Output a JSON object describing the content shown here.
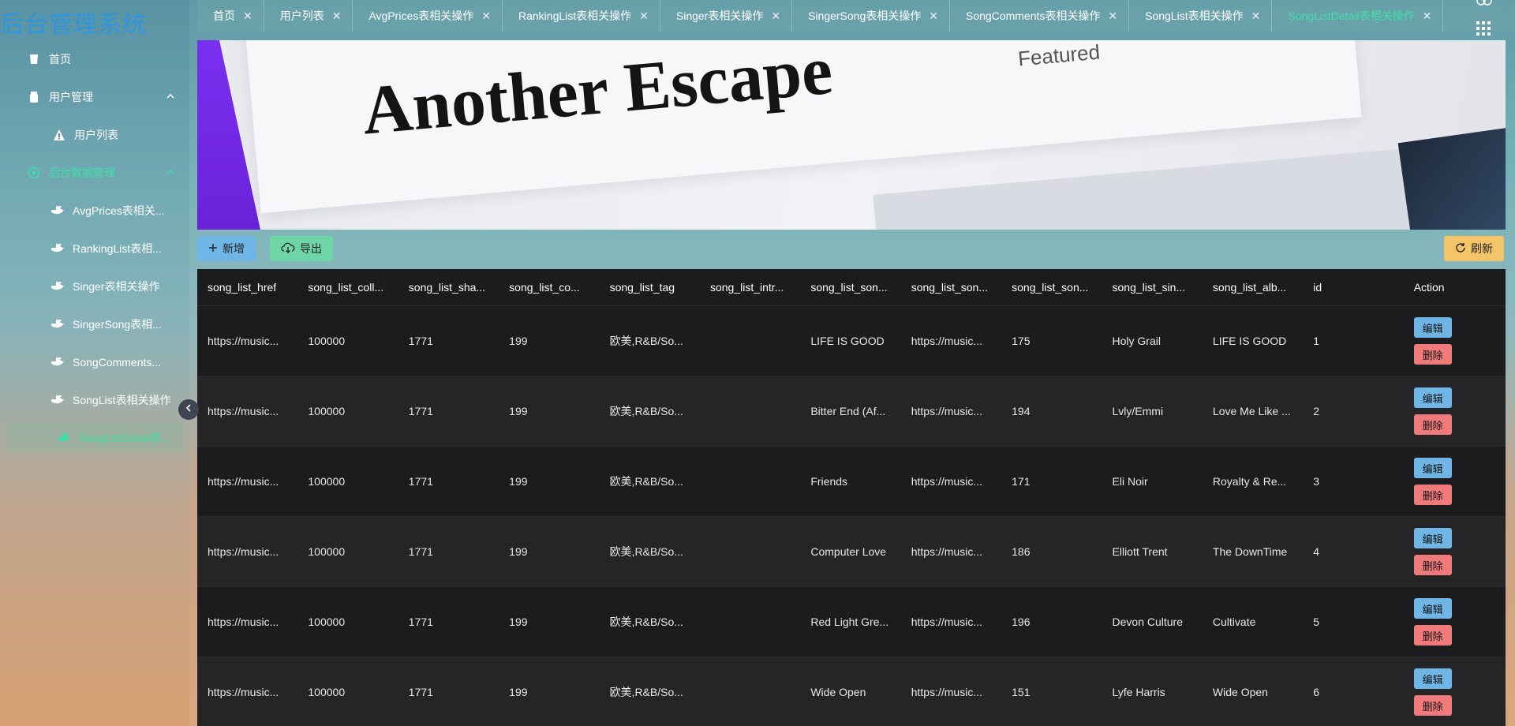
{
  "brand": "后台管理系统",
  "sidebar": {
    "items": [
      {
        "label": "首页",
        "icon": "cup-icon"
      },
      {
        "label": "用户管理",
        "icon": "bottle-icon",
        "expanded": true
      },
      {
        "label": "用户列表",
        "icon": "warning-icon"
      },
      {
        "label": "后台数据管理",
        "icon": "orbit-icon",
        "expanded": true
      },
      {
        "label": "AvgPrices表相关...",
        "icon": "whale-icon"
      },
      {
        "label": "RankingList表相...",
        "icon": "whale-icon"
      },
      {
        "label": "Singer表相关操作",
        "icon": "whale-icon"
      },
      {
        "label": "SingerSong表相...",
        "icon": "whale-icon"
      },
      {
        "label": "SongComments...",
        "icon": "whale-icon"
      },
      {
        "label": "SongList表相关操作",
        "icon": "whale-icon"
      },
      {
        "label": "SongListDetail表...",
        "icon": "whale-icon"
      }
    ]
  },
  "tabs": [
    {
      "label": "首页"
    },
    {
      "label": "用户列表"
    },
    {
      "label": "AvgPrices表相关操作"
    },
    {
      "label": "RankingList表相关操作"
    },
    {
      "label": "Singer表相关操作"
    },
    {
      "label": "SingerSong表相关操作"
    },
    {
      "label": "SongComments表相关操作"
    },
    {
      "label": "SongList表相关操作"
    },
    {
      "label": "SongListDetail表相关操作"
    }
  ],
  "banner": {
    "title": "Another Escape",
    "feature_text": "Featured",
    "slide_count": 4,
    "active_slide": 1
  },
  "toolbar": {
    "add_label": "新增",
    "export_label": "导出",
    "refresh_label": "刷新"
  },
  "table": {
    "columns": [
      "song_list_href",
      "song_list_coll...",
      "song_list_sha...",
      "song_list_co...",
      "song_list_tag",
      "song_list_intr...",
      "song_list_son...",
      "song_list_son...",
      "song_list_son...",
      "song_list_sin...",
      "song_list_alb...",
      "id",
      "Action"
    ],
    "edit_label": "编辑",
    "delete_label": "删除",
    "rows": [
      [
        "https://music...",
        "100000",
        "1771",
        "199",
        "欧美,R&B/So...",
        "",
        "LIFE IS GOOD",
        "https://music...",
        "175",
        "Holy Grail",
        "LIFE IS GOOD",
        "1"
      ],
      [
        "https://music...",
        "100000",
        "1771",
        "199",
        "欧美,R&B/So...",
        "",
        "Bitter End (Af...",
        "https://music...",
        "194",
        "Lvly/Emmi",
        "Love Me Like ...",
        "2"
      ],
      [
        "https://music...",
        "100000",
        "1771",
        "199",
        "欧美,R&B/So...",
        "",
        "Friends",
        "https://music...",
        "171",
        "Eli Noir",
        "Royalty & Re...",
        "3"
      ],
      [
        "https://music...",
        "100000",
        "1771",
        "199",
        "欧美,R&B/So...",
        "",
        "Computer Love",
        "https://music...",
        "186",
        "Elliott Trent",
        "The DownTime",
        "4"
      ],
      [
        "https://music...",
        "100000",
        "1771",
        "199",
        "欧美,R&B/So...",
        "",
        "Red Light Gre...",
        "https://music...",
        "196",
        "Devon Culture",
        "Cultivate",
        "5"
      ],
      [
        "https://music...",
        "100000",
        "1771",
        "199",
        "欧美,R&B/So...",
        "",
        "Wide Open",
        "https://music...",
        "151",
        "Lyfe Harris",
        "Wide Open",
        "6"
      ]
    ]
  },
  "colors": {
    "accent": "#3fe0a8",
    "primary": "#6fb6e6",
    "success": "#6ed6a6",
    "warning": "#f3c567",
    "danger": "#f07a7a"
  }
}
